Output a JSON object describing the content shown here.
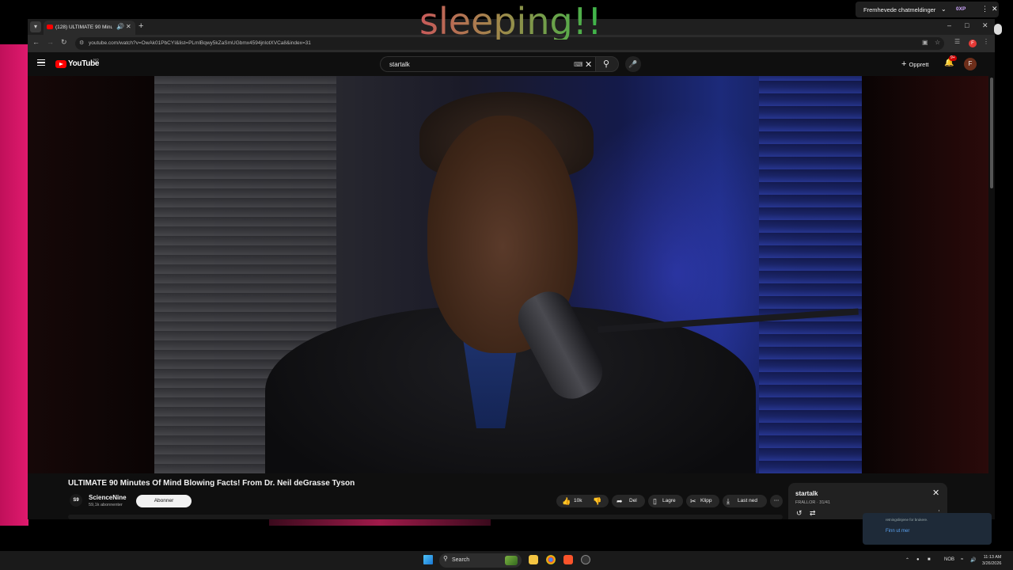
{
  "overlay": {
    "text": "sleeping!!"
  },
  "notification_bar": {
    "label": "Fremhevede chatmeldinger",
    "xp": "0XP"
  },
  "browser": {
    "tab_title": "(128) ULTIMATE 90 Minute...",
    "url": "youtube.com/watch?v=OwAk01PbCYI&list=PLmlBqwy5kZaSmUGbmx4594jnlotXVCa8&index=31"
  },
  "youtube": {
    "logo": "YouTube",
    "region": "NO",
    "search_value": "startalk",
    "create_label": "Opprett",
    "notification_count": "9+",
    "avatar_letter": "F"
  },
  "video": {
    "title": "ULTIMATE 90 Minutes Of Mind Blowing Facts! From Dr. Neil deGrasse Tyson",
    "channel": "ScienceNine",
    "channel_avatar": "S9",
    "subscribers": "59,1k abonnenter",
    "subscribe_label": "Abonner",
    "likes": "10k",
    "share_label": "Del",
    "save_label": "Lagre",
    "clip_label": "Klipp",
    "download_label": "Last ned"
  },
  "playlist": {
    "title": "startalk",
    "subtitle": "FRALLOR · 31/41"
  },
  "toast": {
    "line1": "retningslinjene for brukere.",
    "link": "Finn ut mer"
  },
  "taskbar": {
    "search_label": "Search",
    "lang": "NOB",
    "time": "11:13 AM",
    "date": "3/26/2026"
  }
}
